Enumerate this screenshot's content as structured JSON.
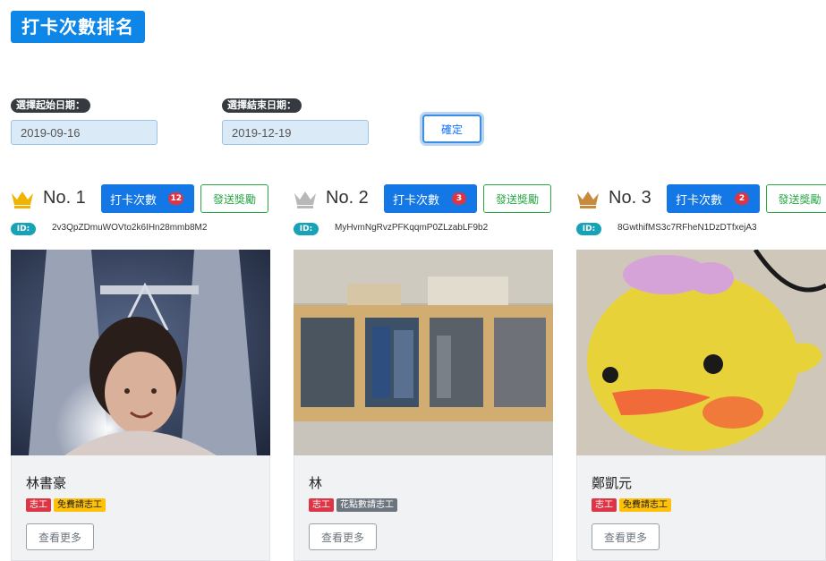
{
  "page": {
    "title": "打卡次數排名"
  },
  "filters": {
    "start_label": "選擇起始日期：",
    "start_value": "2019-09-16",
    "end_label": "選擇結束日期：",
    "end_value": "2019-12-19",
    "confirm_label": "確定"
  },
  "colors": {
    "gold": "#f0b400",
    "silver": "#b8b8b8",
    "bronze": "#c98a3b",
    "primary": "#1477e6",
    "success": "#28a745"
  },
  "cards": [
    {
      "rank": "No. 1",
      "crown": "gold-crown-icon",
      "count_label": "打卡次數",
      "count": "12",
      "reward_label": "發送獎勵",
      "id_label": "ID:",
      "id": "2v3QpZDmuWOVto2k6IHn28mmb8M2",
      "photo": "person-at-night-towers-photo",
      "name": "林書豪",
      "tags": [
        "志工",
        "免費請志工"
      ],
      "more_label": "查看更多"
    },
    {
      "rank": "No. 2",
      "crown": "silver-crown-icon",
      "count_label": "打卡次數",
      "count": "3",
      "reward_label": "發送獎勵",
      "id_label": "ID:",
      "id": "MyHvmNgRvzPFKqqmP0ZLzabLF9b2",
      "photo": "bookshelf-photo",
      "name": "林",
      "tags": [
        "志工",
        "花點數請志工"
      ],
      "more_label": "查看更多"
    },
    {
      "rank": "No. 3",
      "crown": "bronze-crown-icon",
      "count_label": "打卡次數",
      "count": "2",
      "reward_label": "發送獎勵",
      "id_label": "ID:",
      "id": "8GwthifMS3c7RFheN1DzDTfxejA3",
      "photo": "yellow-chick-plush-photo",
      "name": "鄭凱元",
      "tags": [
        "志工",
        "免費請志工"
      ],
      "more_label": "查看更多"
    }
  ]
}
